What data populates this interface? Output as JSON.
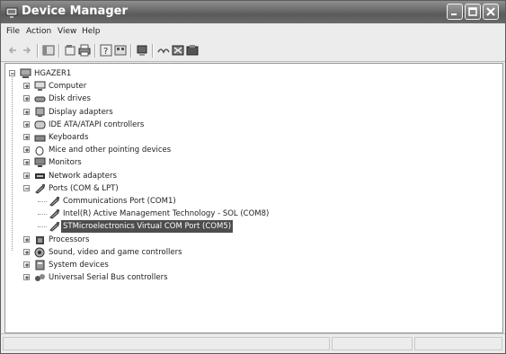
{
  "window": {
    "title": "Device Manager"
  },
  "menu": [
    "File",
    "Action",
    "View",
    "Help"
  ],
  "toolbar": [
    "back-icon",
    "forward-icon",
    "show-hide-tree-icon",
    "properties-icon",
    "print-icon",
    "help-icon",
    "view-icon",
    "update-driver-icon",
    "uninstall-icon",
    "scan-hardware-icon",
    "disable-icon"
  ],
  "tree": {
    "root": "HGAZER1",
    "categories": [
      {
        "label": "Computer",
        "icon": "computer-icon"
      },
      {
        "label": "Disk drives",
        "icon": "disk-icon"
      },
      {
        "label": "Display adapters",
        "icon": "display-icon"
      },
      {
        "label": "IDE ATA/ATAPI controllers",
        "icon": "ide-icon"
      },
      {
        "label": "Keyboards",
        "icon": "keyboard-icon"
      },
      {
        "label": "Mice and other pointing devices",
        "icon": "mouse-icon"
      },
      {
        "label": "Monitors",
        "icon": "monitor-icon"
      },
      {
        "label": "Network adapters",
        "icon": "network-icon"
      },
      {
        "label": "Ports (COM & LPT)",
        "icon": "port-icon",
        "expanded": true,
        "children": [
          {
            "label": "Communications Port (COM1)",
            "icon": "port-icon"
          },
          {
            "label": "Intel(R) Active Management Technology - SOL (COM8)",
            "icon": "port-icon"
          },
          {
            "label": "STMicroelectronics Virtual COM Port (COM5)",
            "icon": "port-icon",
            "selected": true
          }
        ]
      },
      {
        "label": "Processors",
        "icon": "processor-icon"
      },
      {
        "label": "Sound, video and game controllers",
        "icon": "sound-icon"
      },
      {
        "label": "System devices",
        "icon": "system-icon"
      },
      {
        "label": "Universal Serial Bus controllers",
        "icon": "usb-icon"
      }
    ]
  }
}
